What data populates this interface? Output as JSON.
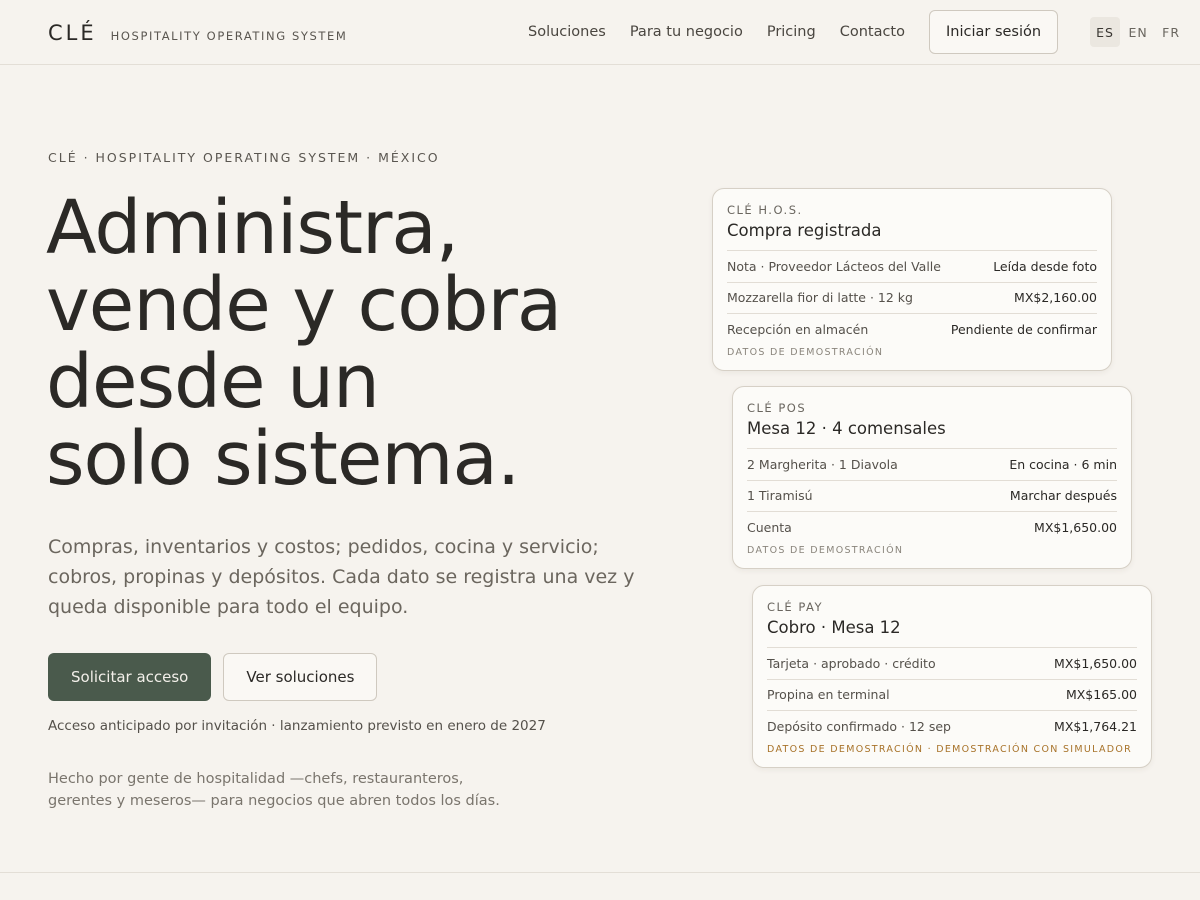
{
  "header": {
    "logo": "CLÉ",
    "tagline": "HOSPITALITY OPERATING SYSTEM",
    "nav": [
      "Soluciones",
      "Para tu negocio",
      "Pricing",
      "Contacto"
    ],
    "login_label": "Iniciar sesión",
    "languages": [
      "ES",
      "EN",
      "FR"
    ],
    "active_language": "ES"
  },
  "hero": {
    "eyebrow": "CLÉ · HOSPITALITY OPERATING SYSTEM · MÉXICO",
    "headline_lines": [
      "Administra,",
      "vende y cobra",
      "desde un",
      "solo sistema."
    ],
    "subhead": "Compras, inventarios y costos; pedidos, cocina y servicio; cobros, propinas y depósitos. Cada dato se registra una vez y queda disponible para todo el equipo.",
    "primary_cta": "Solicitar acceso",
    "secondary_cta": "Ver soluciones",
    "access_note": "Acceso anticipado por invitación · lanzamiento previsto en enero de 2027",
    "made_by": "Hecho por gente de hospitalidad —chefs, restauranteros, gerentes y meseros— para negocios que abren todos los días."
  },
  "cards": [
    {
      "label": "CLÉ H.O.S.",
      "title": "Compra registrada",
      "rows": [
        {
          "k": "Nota · Proveedor Lácteos del Valle",
          "v": "Leída desde foto"
        },
        {
          "k": "Mozzarella fior di latte · 12 kg",
          "v": "MX$2,160.00"
        },
        {
          "k": "Recepción en almacén",
          "v": "Pendiente de confirmar"
        }
      ],
      "footer": "DATOS DE DEMOSTRACIÓN"
    },
    {
      "label": "CLÉ POS",
      "title": "Mesa 12 · 4 comensales",
      "rows": [
        {
          "k": "2 Margherita · 1 Diavola",
          "v": "En cocina · 6 min"
        },
        {
          "k": "1 Tiramisú",
          "v": "Marchar después"
        },
        {
          "k": "Cuenta",
          "v": "MX$1,650.00"
        }
      ],
      "footer": "DATOS DE DEMOSTRACIÓN"
    },
    {
      "label": "CLÉ PAY",
      "title": "Cobro · Mesa 12",
      "rows": [
        {
          "k": "Tarjeta · aprobado · crédito",
          "v": "MX$1,650.00"
        },
        {
          "k": "Propina en terminal",
          "v": "MX$165.00"
        },
        {
          "k": "Depósito confirmado · 12 sep",
          "v": "MX$1,764.21"
        }
      ],
      "footer": "DATOS DE DEMOSTRACIÓN · DEMOSTRACIÓN CON SIMULADOR"
    }
  ],
  "colors": {
    "background": "#f6f3ee",
    "primary_button": "#4a5a4c",
    "accent_footer": "#a8732a"
  }
}
